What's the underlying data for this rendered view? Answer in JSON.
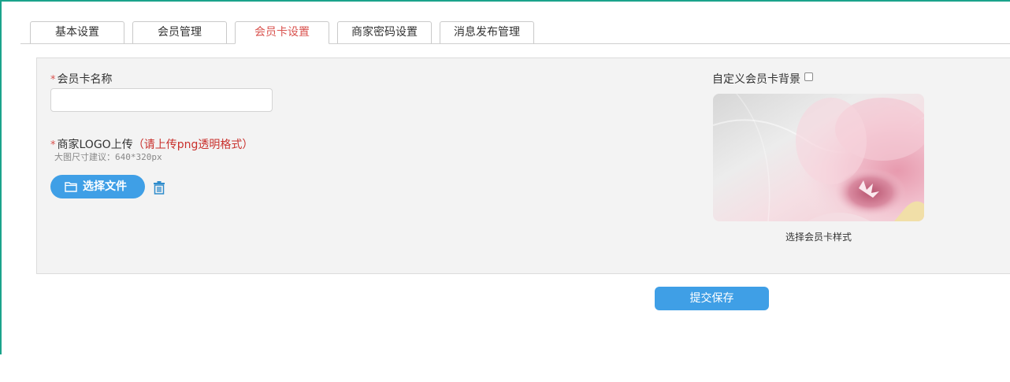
{
  "tabs": [
    {
      "label": "基本设置",
      "active": false
    },
    {
      "label": "会员管理",
      "active": false
    },
    {
      "label": "会员卡设置",
      "active": true
    },
    {
      "label": "商家密码设置",
      "active": false
    },
    {
      "label": "消息发布管理",
      "active": false
    }
  ],
  "form": {
    "required_mark": "*",
    "card_name": {
      "label": "会员卡名称",
      "value": "",
      "placeholder": ""
    },
    "logo": {
      "label": "商家LOGO上传",
      "note": "（请上传png透明格式）",
      "size_hint": "大图尺寸建议：640*320px",
      "upload_button_label": "选择文件"
    },
    "custom_background": {
      "label": "自定义会员卡背景",
      "checked": false
    },
    "card_style_caption": "选择会员卡样式"
  },
  "submit_label": "提交保存",
  "icons": {
    "upload": "folder-icon",
    "delete": "trash-icon"
  },
  "colors": {
    "accent_blue": "#3f9fe6",
    "active_tab_red": "#d9534f",
    "frame_teal": "#1aa38b",
    "panel_bg": "#f3f3f3"
  }
}
